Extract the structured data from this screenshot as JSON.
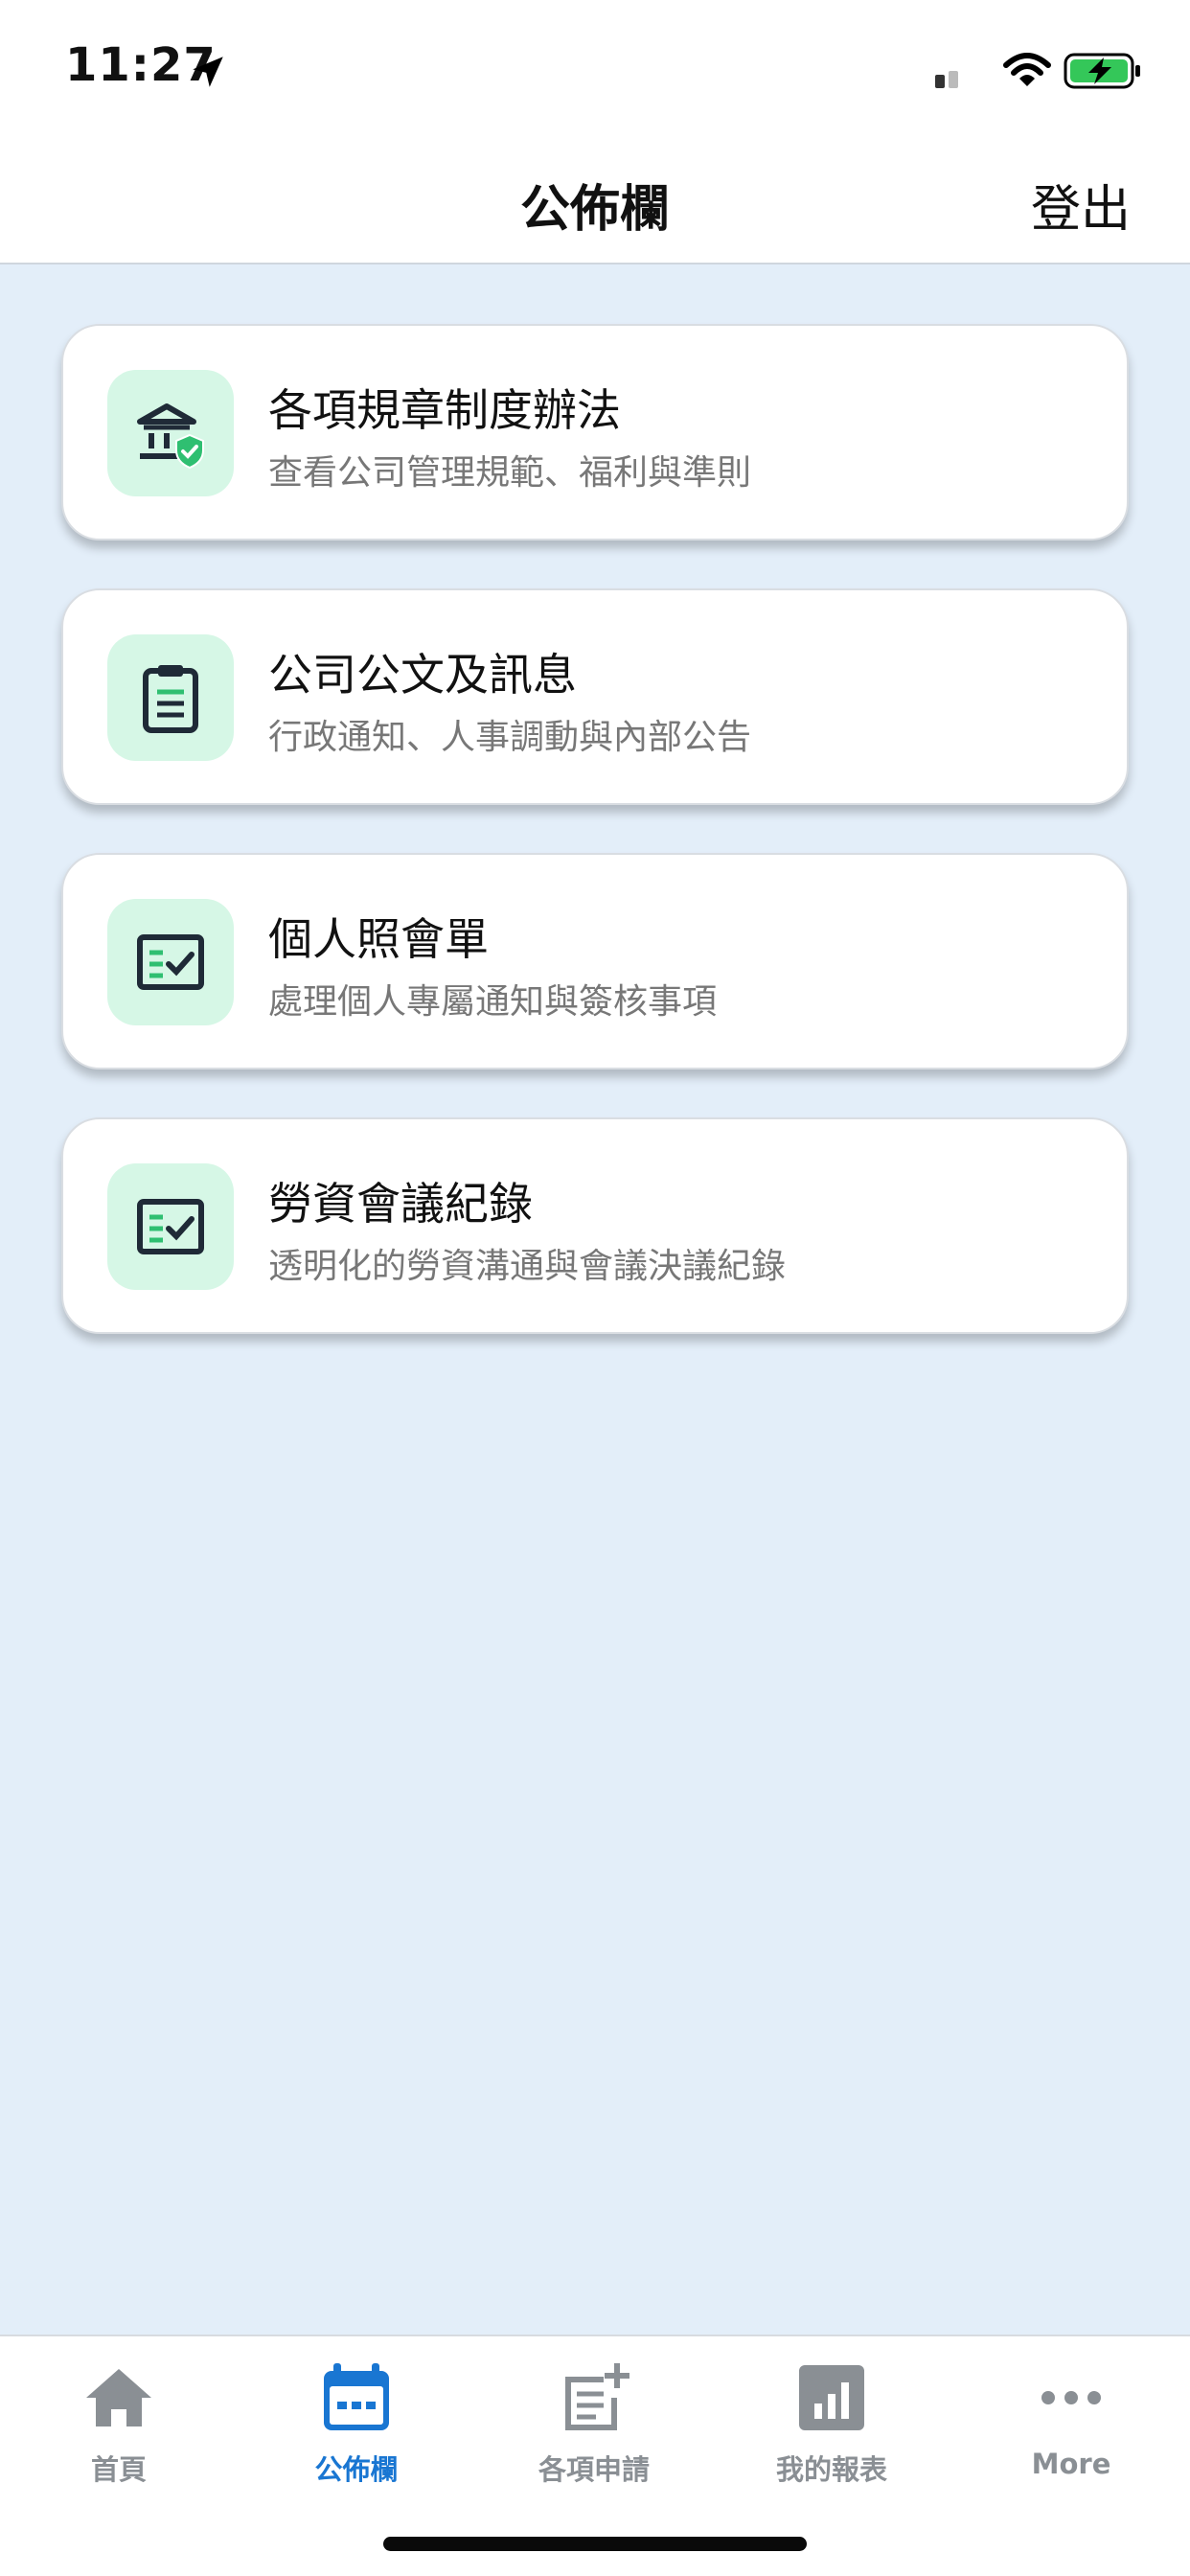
{
  "status_bar": {
    "time": "11:27",
    "icons": [
      "location-arrow-icon",
      "signal-icon",
      "wifi-icon",
      "battery-charging-icon"
    ],
    "battery_color": "#34c759"
  },
  "header": {
    "title": "公佈欄",
    "logout_label": "登出"
  },
  "cards": [
    {
      "title": "各項規章制度辦法",
      "subtitle": "查看公司管理規範、福利與準則",
      "icon": "bank-shield-icon"
    },
    {
      "title": "公司公文及訊息",
      "subtitle": "行政通知、人事調動與內部公告",
      "icon": "clipboard-icon"
    },
    {
      "title": "個人照會單",
      "subtitle": "處理個人專屬通知與簽核事項",
      "icon": "checklist-icon"
    },
    {
      "title": "勞資會議紀錄",
      "subtitle": "透明化的勞資溝通與會議決議紀錄",
      "icon": "checklist-icon"
    }
  ],
  "colors": {
    "background": "#e3eef9",
    "icon_tile": "#d6f7e6",
    "icon_accent": "#2fbf71",
    "tab_active": "#1976d2",
    "tab_inactive": "#8a8f94"
  },
  "tab_bar": {
    "active_index": 1,
    "tabs": [
      {
        "label": "首頁",
        "icon": "home-icon"
      },
      {
        "label": "公佈欄",
        "icon": "calendar-icon"
      },
      {
        "label": "各項申請",
        "icon": "document-add-icon"
      },
      {
        "label": "我的報表",
        "icon": "bar-chart-icon"
      },
      {
        "label": "More",
        "icon": "more-dots-icon"
      }
    ]
  }
}
